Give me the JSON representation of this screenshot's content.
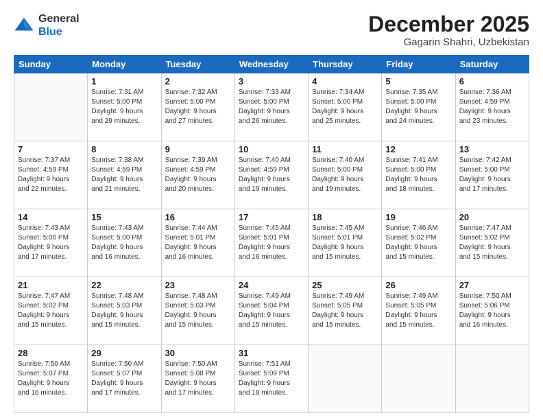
{
  "logo": {
    "general": "General",
    "blue": "Blue"
  },
  "header": {
    "month": "December 2025",
    "location": "Gagarin Shahri, Uzbekistan"
  },
  "days_of_week": [
    "Sunday",
    "Monday",
    "Tuesday",
    "Wednesday",
    "Thursday",
    "Friday",
    "Saturday"
  ],
  "weeks": [
    [
      {
        "day": "",
        "info": ""
      },
      {
        "day": "1",
        "info": "Sunrise: 7:31 AM\nSunset: 5:00 PM\nDaylight: 9 hours\nand 29 minutes."
      },
      {
        "day": "2",
        "info": "Sunrise: 7:32 AM\nSunset: 5:00 PM\nDaylight: 9 hours\nand 27 minutes."
      },
      {
        "day": "3",
        "info": "Sunrise: 7:33 AM\nSunset: 5:00 PM\nDaylight: 9 hours\nand 26 minutes."
      },
      {
        "day": "4",
        "info": "Sunrise: 7:34 AM\nSunset: 5:00 PM\nDaylight: 9 hours\nand 25 minutes."
      },
      {
        "day": "5",
        "info": "Sunrise: 7:35 AM\nSunset: 5:00 PM\nDaylight: 9 hours\nand 24 minutes."
      },
      {
        "day": "6",
        "info": "Sunrise: 7:36 AM\nSunset: 4:59 PM\nDaylight: 9 hours\nand 23 minutes."
      }
    ],
    [
      {
        "day": "7",
        "info": "Sunrise: 7:37 AM\nSunset: 4:59 PM\nDaylight: 9 hours\nand 22 minutes."
      },
      {
        "day": "8",
        "info": "Sunrise: 7:38 AM\nSunset: 4:59 PM\nDaylight: 9 hours\nand 21 minutes."
      },
      {
        "day": "9",
        "info": "Sunrise: 7:39 AM\nSunset: 4:59 PM\nDaylight: 9 hours\nand 20 minutes."
      },
      {
        "day": "10",
        "info": "Sunrise: 7:40 AM\nSunset: 4:59 PM\nDaylight: 9 hours\nand 19 minutes."
      },
      {
        "day": "11",
        "info": "Sunrise: 7:40 AM\nSunset: 5:00 PM\nDaylight: 9 hours\nand 19 minutes."
      },
      {
        "day": "12",
        "info": "Sunrise: 7:41 AM\nSunset: 5:00 PM\nDaylight: 9 hours\nand 18 minutes."
      },
      {
        "day": "13",
        "info": "Sunrise: 7:42 AM\nSunset: 5:00 PM\nDaylight: 9 hours\nand 17 minutes."
      }
    ],
    [
      {
        "day": "14",
        "info": "Sunrise: 7:43 AM\nSunset: 5:00 PM\nDaylight: 9 hours\nand 17 minutes."
      },
      {
        "day": "15",
        "info": "Sunrise: 7:43 AM\nSunset: 5:00 PM\nDaylight: 9 hours\nand 16 minutes."
      },
      {
        "day": "16",
        "info": "Sunrise: 7:44 AM\nSunset: 5:01 PM\nDaylight: 9 hours\nand 16 minutes."
      },
      {
        "day": "17",
        "info": "Sunrise: 7:45 AM\nSunset: 5:01 PM\nDaylight: 9 hours\nand 16 minutes."
      },
      {
        "day": "18",
        "info": "Sunrise: 7:45 AM\nSunset: 5:01 PM\nDaylight: 9 hours\nand 15 minutes."
      },
      {
        "day": "19",
        "info": "Sunrise: 7:46 AM\nSunset: 5:02 PM\nDaylight: 9 hours\nand 15 minutes."
      },
      {
        "day": "20",
        "info": "Sunrise: 7:47 AM\nSunset: 5:02 PM\nDaylight: 9 hours\nand 15 minutes."
      }
    ],
    [
      {
        "day": "21",
        "info": "Sunrise: 7:47 AM\nSunset: 5:02 PM\nDaylight: 9 hours\nand 15 minutes."
      },
      {
        "day": "22",
        "info": "Sunrise: 7:48 AM\nSunset: 5:03 PM\nDaylight: 9 hours\nand 15 minutes."
      },
      {
        "day": "23",
        "info": "Sunrise: 7:48 AM\nSunset: 5:03 PM\nDaylight: 9 hours\nand 15 minutes."
      },
      {
        "day": "24",
        "info": "Sunrise: 7:49 AM\nSunset: 5:04 PM\nDaylight: 9 hours\nand 15 minutes."
      },
      {
        "day": "25",
        "info": "Sunrise: 7:49 AM\nSunset: 5:05 PM\nDaylight: 9 hours\nand 15 minutes."
      },
      {
        "day": "26",
        "info": "Sunrise: 7:49 AM\nSunset: 5:05 PM\nDaylight: 9 hours\nand 15 minutes."
      },
      {
        "day": "27",
        "info": "Sunrise: 7:50 AM\nSunset: 5:06 PM\nDaylight: 9 hours\nand 16 minutes."
      }
    ],
    [
      {
        "day": "28",
        "info": "Sunrise: 7:50 AM\nSunset: 5:07 PM\nDaylight: 9 hours\nand 16 minutes."
      },
      {
        "day": "29",
        "info": "Sunrise: 7:50 AM\nSunset: 5:07 PM\nDaylight: 9 hours\nand 17 minutes."
      },
      {
        "day": "30",
        "info": "Sunrise: 7:50 AM\nSunset: 5:08 PM\nDaylight: 9 hours\nand 17 minutes."
      },
      {
        "day": "31",
        "info": "Sunrise: 7:51 AM\nSunset: 5:09 PM\nDaylight: 9 hours\nand 18 minutes."
      },
      {
        "day": "",
        "info": ""
      },
      {
        "day": "",
        "info": ""
      },
      {
        "day": "",
        "info": ""
      }
    ]
  ]
}
